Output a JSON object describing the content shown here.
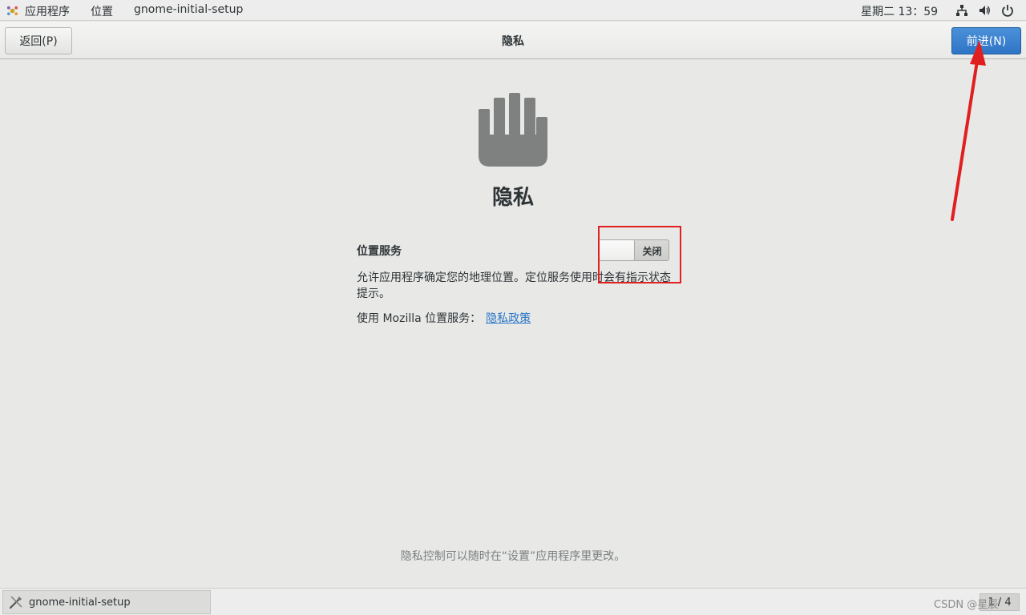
{
  "top_panel": {
    "apps_menu": "应用程序",
    "places_menu": "位置",
    "window_title": "gnome-initial-setup",
    "clock": "星期二 13：59",
    "icons": [
      "network-icon",
      "volume-icon",
      "power-icon"
    ]
  },
  "header": {
    "back_label": "返回(P)",
    "title": "隐私",
    "next_label": "前进(N)"
  },
  "main": {
    "icon": "hand-stop-icon",
    "heading": "隐私",
    "location_label": "位置服务",
    "switch_state": "关闭",
    "description": "允许应用程序确定您的地理位置。定位服务使用时会有指示状态提示。",
    "mozilla_text": "使用 Mozilla 位置服务：",
    "policy_link": "隐私政策",
    "footer_note": "隐私控制可以随时在“设置”应用程序里更改。"
  },
  "bottom_panel": {
    "task_label": "gnome-initial-setup",
    "workspace": "1 / 4",
    "watermark": "CSDN @星辰"
  },
  "colors": {
    "accent": "#3584e4",
    "annotation": "#e02020",
    "link": "#2a76c6"
  }
}
